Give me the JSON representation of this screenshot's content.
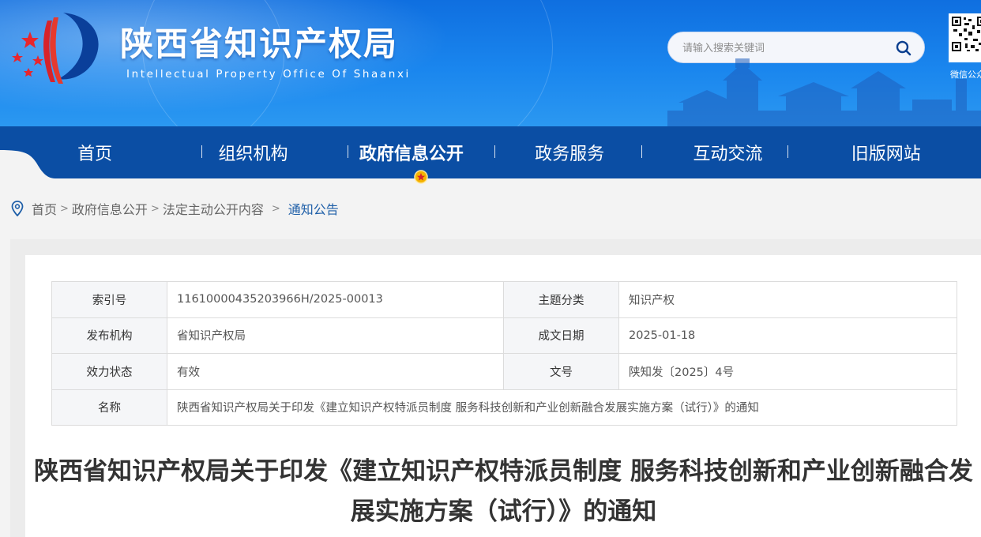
{
  "header": {
    "title": "陕西省知识产权局",
    "subtitle": "Intellectual Property Office Of Shaanxi",
    "search_placeholder": "请输入搜索关键词",
    "qr_label": "微信公众号",
    "colors": {
      "banner": "#1a86ee",
      "nav": "#0b4ea4",
      "accent_dot": "#f2b400"
    }
  },
  "nav": {
    "items": [
      {
        "label": "首页"
      },
      {
        "label": "组织机构"
      },
      {
        "label": "政府信息公开",
        "active": true
      },
      {
        "label": "政务服务"
      },
      {
        "label": "互动交流"
      },
      {
        "label": "旧版网站"
      }
    ]
  },
  "breadcrumb": {
    "items": [
      "首页",
      "政府信息公开",
      "法定主动公开内容"
    ],
    "current": "通知公告"
  },
  "meta": {
    "index_label": "索引号",
    "index_value": "11610000435203966H/2025-00013",
    "category_label": "主题分类",
    "category_value": "知识产权",
    "publisher_label": "发布机构",
    "publisher_value": "省知识产权局",
    "date_label": "成文日期",
    "date_value": "2025-01-18",
    "status_label": "效力状态",
    "status_value": "有效",
    "doc_no_label": "文号",
    "doc_no_value": "陕知发〔2025〕4号",
    "name_label": "名称",
    "name_value": "陕西省知识产权局关于印发《建立知识产权特派员制度 服务科技创新和产业创新融合发展实施方案（试行）》的通知"
  },
  "document": {
    "title": "陕西省知识产权局关于印发《建立知识产权特派员制度 服务科技创新和产业创新融合发展实施方案（试行）》的通知"
  }
}
